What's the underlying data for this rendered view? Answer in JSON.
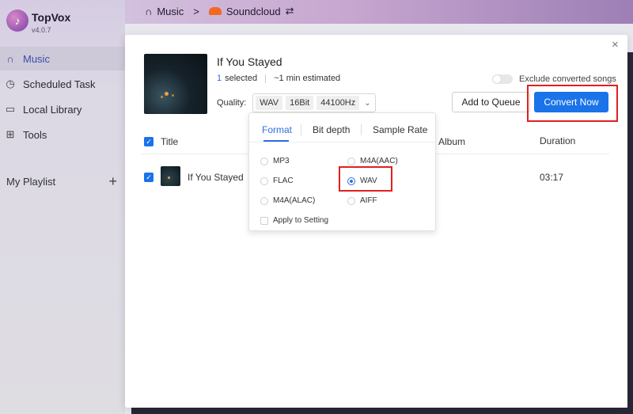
{
  "app": {
    "name": "TopVox",
    "version": "v4.0.7"
  },
  "sidebar": {
    "items": [
      {
        "label": "Music",
        "icon": "headphones-icon",
        "active": true
      },
      {
        "label": "Scheduled Task",
        "icon": "clock-icon"
      },
      {
        "label": "Local Library",
        "icon": "folder-icon"
      },
      {
        "label": "Tools",
        "icon": "grid-icon"
      }
    ],
    "playlist_label": "My Playlist",
    "playlist_add": "+"
  },
  "breadcrumb": {
    "music": "Music",
    "sep": ">",
    "source": "Soundcloud",
    "switch": "⇄"
  },
  "modal": {
    "close": "×",
    "song_title": "If You Stayed",
    "selected_count": "1",
    "selected_label": "selected",
    "estimate": "~1 min estimated",
    "quality_label": "Quality:",
    "quality_chips": {
      "format": "WAV",
      "bitdepth": "16Bit",
      "samplerate": "44100Hz"
    },
    "exclude_label": "Exclude converted songs",
    "add_to_queue": "Add to Queue",
    "convert_now": "Convert Now",
    "table": {
      "headers": {
        "title": "Title",
        "album": "Album",
        "duration": "Duration"
      },
      "rows": [
        {
          "title": "If You Stayed",
          "album": "",
          "duration": "03:17"
        }
      ]
    },
    "dropdown": {
      "tabs": [
        "Format",
        "Bit depth",
        "Sample Rate"
      ],
      "active_tab": "Format",
      "formats": [
        "MP3",
        "M4A(AAC)",
        "FLAC",
        "WAV",
        "M4A(ALAC)",
        "AIFF"
      ],
      "selected_format": "WAV",
      "apply_label": "Apply to Setting"
    }
  },
  "colors": {
    "accent": "#1a73e8",
    "highlight": "#e02020"
  }
}
